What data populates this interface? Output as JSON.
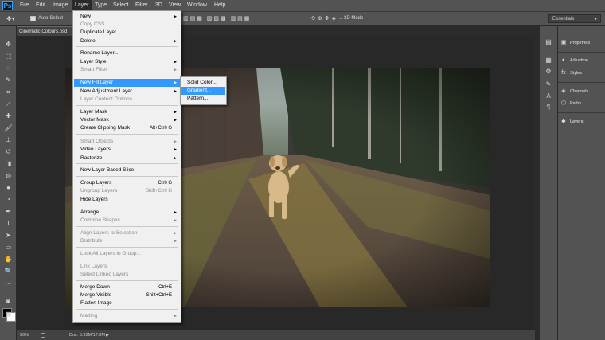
{
  "app": {
    "logo": "Ps"
  },
  "menubar": {
    "items": [
      {
        "label": "File"
      },
      {
        "label": "Edit"
      },
      {
        "label": "Image"
      },
      {
        "label": "Layer"
      },
      {
        "label": "Type"
      },
      {
        "label": "Select"
      },
      {
        "label": "Filter"
      },
      {
        "label": "3D"
      },
      {
        "label": "View"
      },
      {
        "label": "Window"
      },
      {
        "label": "Help"
      }
    ]
  },
  "options_bar": {
    "auto_select_label": "Auto-Select",
    "mode_label": "3D Mode",
    "workspace": "Essentials"
  },
  "document": {
    "tab_title": "Cinematic Colours.psd",
    "zoom": "50%",
    "doc_info": "Doc: 5.93M/17.8M"
  },
  "layer_menu": {
    "items": [
      {
        "label": "New",
        "disabled": false,
        "submenu": true
      },
      {
        "label": "Copy CSS",
        "disabled": true
      },
      {
        "label": "Duplicate Layer...",
        "disabled": false
      },
      {
        "label": "Delete",
        "disabled": false,
        "submenu": true
      },
      {
        "label": "Rename Layer...",
        "disabled": false
      },
      {
        "label": "Layer Style",
        "disabled": false,
        "submenu": true
      },
      {
        "label": "Smart Filter",
        "disabled": true,
        "submenu": true
      },
      {
        "label": "New Fill Layer",
        "disabled": false,
        "submenu": true,
        "highlighted": true
      },
      {
        "label": "New Adjustment Layer",
        "disabled": false,
        "submenu": true
      },
      {
        "label": "Layer Content Options...",
        "disabled": true
      },
      {
        "label": "Layer Mask",
        "disabled": false,
        "submenu": true
      },
      {
        "label": "Vector Mask",
        "disabled": false,
        "submenu": true
      },
      {
        "label": "Create Clipping Mask",
        "disabled": false,
        "shortcut": "Alt+Ctrl+G"
      },
      {
        "label": "Smart Objects",
        "disabled": true,
        "submenu": true
      },
      {
        "label": "Video Layers",
        "disabled": false,
        "submenu": true
      },
      {
        "label": "Rasterize",
        "disabled": false,
        "submenu": true
      },
      {
        "label": "New Layer Based Slice",
        "disabled": false
      },
      {
        "label": "Group Layers",
        "disabled": false,
        "shortcut": "Ctrl+G"
      },
      {
        "label": "Ungroup Layers",
        "disabled": true,
        "shortcut": "Shift+Ctrl+G"
      },
      {
        "label": "Hide Layers",
        "disabled": false
      },
      {
        "label": "Arrange",
        "disabled": false,
        "submenu": true
      },
      {
        "label": "Combine Shapes",
        "disabled": true,
        "submenu": true
      },
      {
        "label": "Align Layers to Selection",
        "disabled": true,
        "submenu": true
      },
      {
        "label": "Distribute",
        "disabled": true,
        "submenu": true
      },
      {
        "label": "Lock All Layers in Group...",
        "disabled": true
      },
      {
        "label": "Link Layers",
        "disabled": true
      },
      {
        "label": "Select Linked Layers",
        "disabled": true
      },
      {
        "label": "Merge Down",
        "disabled": false,
        "shortcut": "Ctrl+E"
      },
      {
        "label": "Merge Visible",
        "disabled": false,
        "shortcut": "Shift+Ctrl+E"
      },
      {
        "label": "Flatten Image",
        "disabled": false
      },
      {
        "label": "Matting",
        "disabled": true,
        "submenu": true
      }
    ]
  },
  "fill_submenu": {
    "items": [
      {
        "label": "Solid Color..."
      },
      {
        "label": "Gradient...",
        "highlighted": true
      },
      {
        "label": "Pattern..."
      }
    ]
  },
  "panels": {
    "items": [
      {
        "label": "Properties",
        "icon": "properties-icon"
      },
      {
        "label": "Adjustme...",
        "icon": "adjustments-icon"
      },
      {
        "label": "Styles",
        "icon": "styles-icon"
      },
      {
        "label": "Channels",
        "icon": "channels-icon"
      },
      {
        "label": "Paths",
        "icon": "paths-icon"
      },
      {
        "label": "Layers",
        "icon": "layers-icon"
      }
    ]
  },
  "colors": {
    "menu_highlight": "#3399ff",
    "ui_gray": "#535353",
    "canvas_bg": "#282828",
    "foreground": "#000000",
    "background": "#ffffff"
  }
}
